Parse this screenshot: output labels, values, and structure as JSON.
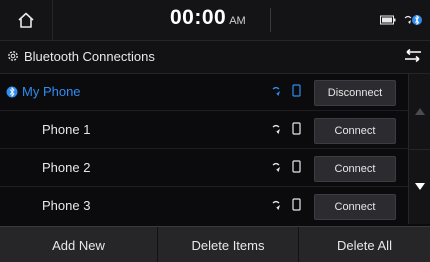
{
  "status_bar": {
    "time": "00:00",
    "ampm": "AM",
    "icons": [
      "home-icon",
      "battery-icon",
      "bluetooth-phone-icon"
    ]
  },
  "title_bar": {
    "title": "Bluetooth Connections",
    "icons": [
      "gear-icon",
      "back-arrow-icon"
    ]
  },
  "devices": [
    {
      "name": "My Phone",
      "action": "Disconnect",
      "connected": true
    },
    {
      "name": "Phone 1",
      "action": "Connect",
      "connected": false
    },
    {
      "name": "Phone 2",
      "action": "Connect",
      "connected": false
    },
    {
      "name": "Phone 3",
      "action": "Connect",
      "connected": false
    }
  ],
  "bottom_buttons": {
    "add_new": "Add New",
    "delete_items": "Delete Items",
    "delete_all": "Delete All"
  },
  "colors": {
    "accent_blue": "#2f8cf0",
    "background": "#0b0b0d",
    "button_bg": "#2c2c30"
  }
}
